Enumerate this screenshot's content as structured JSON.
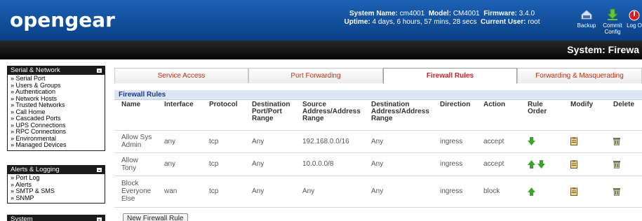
{
  "header": {
    "logo": "opengear",
    "system_name_label": "System Name:",
    "system_name": "cm4001",
    "model_label": "Model:",
    "model": "CM4001",
    "firmware_label": "Firmware:",
    "firmware": "3.4.0",
    "uptime_label": "Uptime:",
    "uptime": "4 days, 6 hours, 57 mins, 28 secs",
    "current_user_label": "Current User:",
    "current_user": "root",
    "backup_label": "Backup",
    "commit_label_1": "Commit",
    "commit_label_2": "Config",
    "logout_label": "Log O"
  },
  "page_title": "System: Firewa",
  "sidebar": {
    "serial_network": {
      "title": "Serial & Network",
      "items": [
        "Serial Port",
        "Users & Groups",
        "Authentication",
        "Network Hosts",
        "Trusted Networks",
        "Call Home",
        "Cascaded Ports",
        "UPS Connections",
        "RPC Connections",
        "Environmental",
        "Managed Devices"
      ]
    },
    "alerts_logging": {
      "title": "Alerts & Logging",
      "items": [
        "Port Log",
        "Alerts",
        "SMTP & SMS",
        "SNMP"
      ]
    },
    "system": {
      "title": "System"
    }
  },
  "tabs": [
    {
      "label": "Service Access",
      "active": false
    },
    {
      "label": "Port Forwarding",
      "active": false
    },
    {
      "label": "Firewall Rules",
      "active": true
    },
    {
      "label": "Forwarding & Masquerading",
      "active": false
    }
  ],
  "panel_title": "Firewall Rules",
  "columns": {
    "name": "Name",
    "interface": "Interface",
    "protocol": "Protocol",
    "dest_port_1": "Destination",
    "dest_port_2": "Port/Port",
    "dest_port_3": "Range",
    "src_addr_1": "Source",
    "src_addr_2": "Address/Address",
    "src_addr_3": "Range",
    "dest_addr_1": "Destination",
    "dest_addr_2": "Address/Address",
    "dest_addr_3": "Range",
    "direction": "Direction",
    "action": "Action",
    "rule_order_1": "Rule",
    "rule_order_2": "Order",
    "modify": "Modify",
    "delete": "Delete"
  },
  "rows": [
    {
      "name_1": "Allow Sys",
      "name_2": "Admin",
      "name_3": "",
      "interface": "any",
      "protocol": "tcp",
      "dest_port": "Any",
      "src_addr": "192.168.0.0/16",
      "dest_addr": "Any",
      "direction": "ingress",
      "action": "accept",
      "order": [
        "down"
      ]
    },
    {
      "name_1": "Allow",
      "name_2": "Tony",
      "name_3": "",
      "interface": "any",
      "protocol": "tcp",
      "dest_port": "Any",
      "src_addr": "10.0.0.0/8",
      "dest_addr": "Any",
      "direction": "ingress",
      "action": "accept",
      "order": [
        "up",
        "down"
      ]
    },
    {
      "name_1": "Block",
      "name_2": "Everyone",
      "name_3": "Else",
      "interface": "wan",
      "protocol": "tcp",
      "dest_port": "Any",
      "src_addr": "Any",
      "dest_addr": "Any",
      "direction": "ingress",
      "action": "block",
      "order": [
        "up"
      ]
    }
  ],
  "new_rule_button": "New Firewall Rule",
  "colors": {
    "header_blue": "#0a3f86",
    "tab_text": "#c03010",
    "panel_title": "#1a3c87",
    "arrow_green": "#3aa52a"
  }
}
